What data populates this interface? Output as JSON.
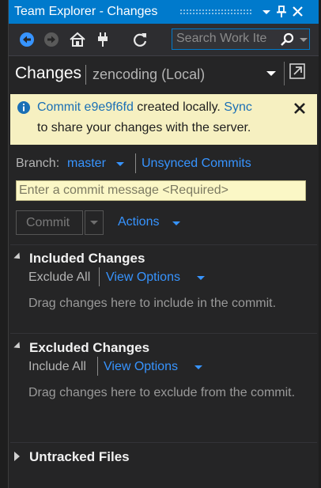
{
  "window": {
    "title": "Team Explorer - Changes",
    "pin_glyph": "📌",
    "close_glyph": "✕"
  },
  "toolbar": {
    "icons": [
      "back-icon",
      "forward-icon",
      "home-icon",
      "connect-icon",
      "refresh-icon"
    ],
    "search_placeholder": "Search Work Ite"
  },
  "header": {
    "title": "Changes",
    "subtitle": "zencoding (Local)"
  },
  "infobar": {
    "commit_link": "Commit e9e9f6fd",
    "text_mid": " created locally. ",
    "sync_link": "Sync",
    "text_line2": "to share your changes with the server."
  },
  "branch": {
    "label": "Branch:",
    "value": "master",
    "unsynced_link": "Unsynced Commits"
  },
  "commit": {
    "message_placeholder": "Enter a commit message <Required>",
    "button_label": "Commit",
    "actions_label": "Actions"
  },
  "sections": {
    "included": {
      "title": "Included Changes",
      "toggle_all": "Exclude All",
      "view_options": "View Options",
      "hint": "Drag changes here to include in the commit."
    },
    "excluded": {
      "title": "Excluded Changes",
      "toggle_all": "Include All",
      "view_options": "View Options",
      "hint": "Drag changes here to exclude from the commit."
    },
    "untracked": {
      "title": "Untracked Files"
    }
  },
  "colors": {
    "accent": "#007acc",
    "link": "#3794ff",
    "infobar_bg": "#f6f0c1",
    "panel_bg": "#252526"
  }
}
